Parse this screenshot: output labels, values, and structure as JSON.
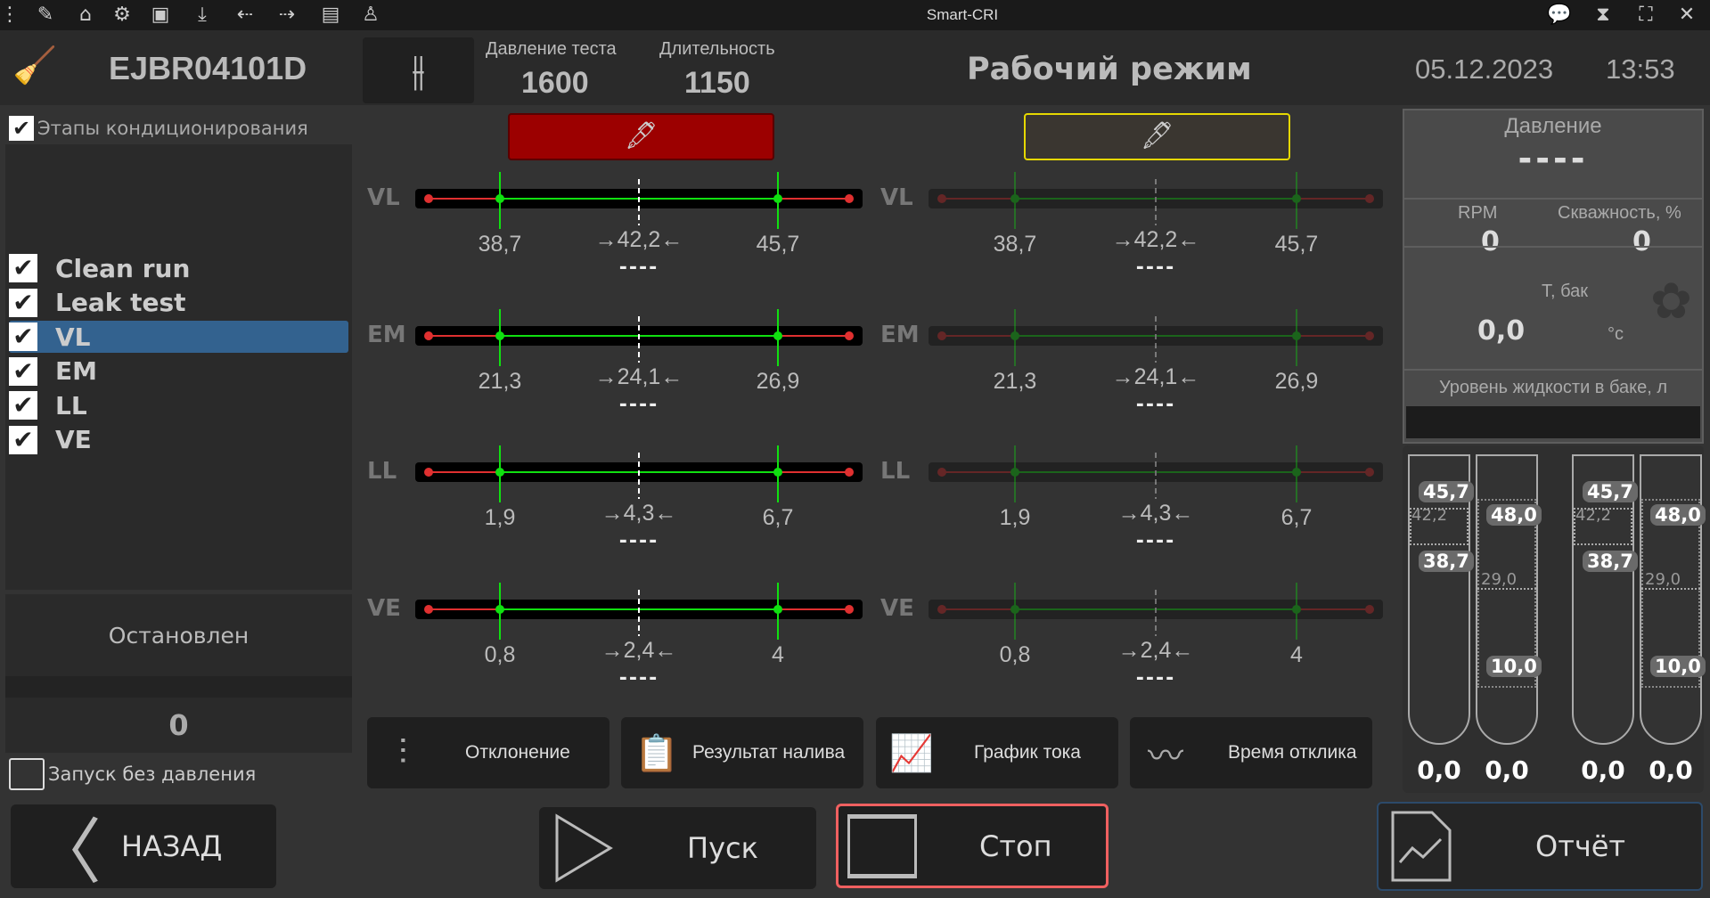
{
  "app_title": "Smart-CRI",
  "toolbar_icons": [
    "menu-dots-icon",
    "pencil-icon",
    "home-icon",
    "gear-icon",
    "toolbox-icon",
    "download-icon",
    "import-icon",
    "export-icon",
    "clipboard-icon",
    "worker-icon"
  ],
  "right_icons": [
    "chat-icon",
    "hourglass-icon",
    "fullscreen-icon",
    "close-icon"
  ],
  "header": {
    "injector_id": "EJBR04101D",
    "pressure_label": "Давление теста",
    "pressure_value": "1600",
    "duration_label": "Длительность",
    "duration_value": "1150",
    "mode": "Рабочий режим",
    "date": "05.12.2023",
    "time": "13:53"
  },
  "stages": {
    "header_label": "Этапы кондиционирования",
    "header_checked": true,
    "items": [
      {
        "label": "Clean run",
        "checked": true
      },
      {
        "label": "Leak test",
        "checked": true
      },
      {
        "label": "VL",
        "checked": true,
        "selected": true
      },
      {
        "label": "EM",
        "checked": true
      },
      {
        "label": "LL",
        "checked": true
      },
      {
        "label": "VE",
        "checked": true
      }
    ]
  },
  "status": {
    "text": "Остановлен",
    "count": "0",
    "no_pressure_label": "Запуск без давления",
    "no_pressure_checked": false
  },
  "gauges": {
    "columns": [
      {
        "color": "#9c0000",
        "border": "#5a0000",
        "active": true
      },
      {
        "color": "#3a3630",
        "border": "#e6d800",
        "active": false
      }
    ],
    "rows": [
      {
        "name": "VL",
        "min": "38,7",
        "target": "→42,2←",
        "max": "45,7",
        "value": "----"
      },
      {
        "name": "EM",
        "min": "21,3",
        "target": "→24,1←",
        "max": "26,9",
        "value": "----"
      },
      {
        "name": "LL",
        "min": "1,9",
        "target": "→4,3←",
        "max": "6,7",
        "value": "----"
      },
      {
        "name": "VE",
        "min": "0,8",
        "target": "→2,4←",
        "max": "4",
        "value": "----"
      }
    ]
  },
  "tools": [
    {
      "label": "Отклонение",
      "icon": "deviation-icon"
    },
    {
      "label": "Результат налива",
      "icon": "checklist-icon"
    },
    {
      "label": "График тока",
      "icon": "current-chart-icon"
    },
    {
      "label": "Время отклика",
      "icon": "response-chart-icon"
    }
  ],
  "actions": {
    "back": "НАЗАД",
    "start": "Пуск",
    "stop": "Стоп",
    "report": "Отчёт"
  },
  "sensors": {
    "pressure_label": "Давление",
    "pressure_value": "----",
    "rpm_label": "RPM",
    "rpm_value": "0",
    "duty_label": "Скважность, %",
    "duty_value": "0",
    "temp_label": "T, бак",
    "temp_value": "0,0",
    "temp_unit": "°c",
    "level_label": "Уровень жидкости в баке, л"
  },
  "tubes": [
    {
      "top": "45,7",
      "mid": "42,2",
      "bottom": "38,7",
      "value": "0,0"
    },
    {
      "top": "48,0",
      "mid": "29,0",
      "bottom": "10,0",
      "value": "0,0"
    },
    {
      "top": "45,7",
      "mid": "42,2",
      "bottom": "38,7",
      "value": "0,0"
    },
    {
      "top": "48,0",
      "mid": "29,0",
      "bottom": "10,0",
      "value": "0,0"
    }
  ]
}
